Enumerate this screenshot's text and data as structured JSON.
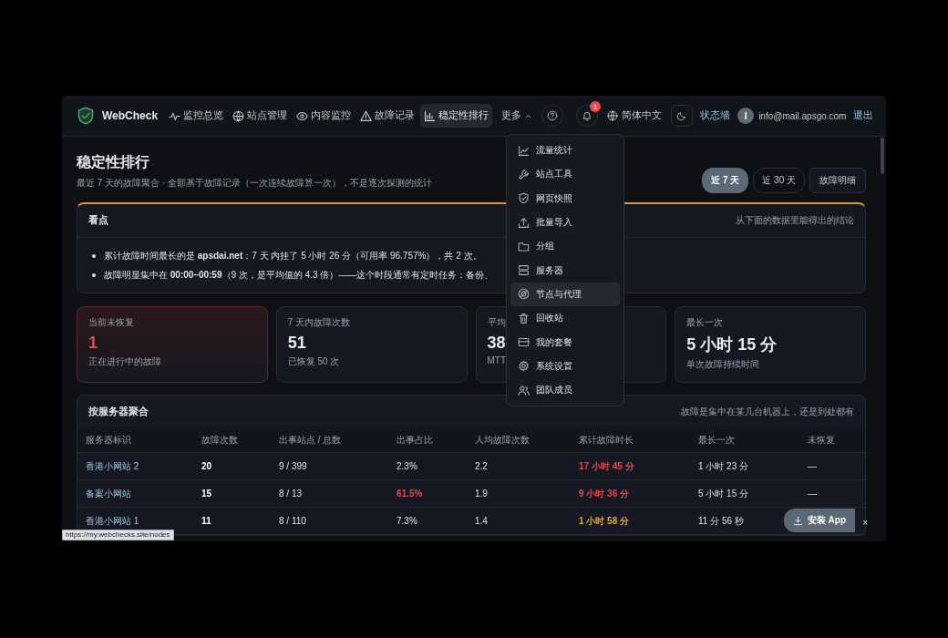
{
  "app": {
    "brand": "WebCheck"
  },
  "nav": [
    {
      "label": "监控总览",
      "selected": false
    },
    {
      "label": "站点管理",
      "selected": false
    },
    {
      "label": "内容监控",
      "selected": false
    },
    {
      "label": "故障记录",
      "selected": false
    },
    {
      "label": "稳定性排行",
      "selected": true
    }
  ],
  "more": {
    "label": "更多",
    "expanded": true
  },
  "notifications": {
    "count": "1"
  },
  "language": "简体中文",
  "status_wall": "状态墙",
  "user": {
    "initial": "I",
    "email": "info@mail.apsgo.com",
    "logout": "退出"
  },
  "menu": [
    {
      "label": "流量统计",
      "selected": false
    },
    {
      "label": "站点工具",
      "selected": false
    },
    {
      "label": "网页快照",
      "selected": false
    },
    {
      "label": "批量导入",
      "selected": false
    },
    {
      "label": "分组",
      "selected": false
    },
    {
      "label": "服务器",
      "selected": false
    },
    {
      "label": "节点与代理",
      "selected": true
    },
    {
      "label": "回收站",
      "selected": false
    },
    {
      "label": "我的套餐",
      "selected": false
    },
    {
      "label": "系统设置",
      "selected": false
    },
    {
      "label": "团队成员",
      "selected": false
    }
  ],
  "page": {
    "title": "稳定性排行",
    "subtitle": "最近 7 天的故障聚合 · 全部基于故障记录（一次连续故障算一次），不是逐次探测的统计"
  },
  "ranges": [
    {
      "label": "近 7 天",
      "selected": true
    },
    {
      "label": "近 30 天",
      "selected": false
    }
  ],
  "detail_button": "故障明细",
  "highlights": {
    "title": "看点",
    "note": "从下面的数据里能得出的结论",
    "items": [
      "累计故障时间最长的是 **apsdai.net**：7 天 内挂了 5 小时 26 分（可用率 96.757%），共 2 次。",
      "故障明显集中在 **00:00–00:59**（9 次，是平均值的 4.3 倍）——这个时段通常有定时任务：备份、"
    ]
  },
  "stats": [
    {
      "label": "当前未恢复",
      "value": "1",
      "sub": "正在进行中的故障",
      "alert": true
    },
    {
      "label": "7 天内故障次数",
      "value": "51",
      "sub": "已恢复 50 次",
      "alert": false
    },
    {
      "label": "平均",
      "value": "38",
      "sub": "MTT",
      "alert": false
    },
    {
      "label": "最长一次",
      "value": "5 小时 15 分",
      "sub": "单次故障持续时间",
      "alert": false
    }
  ],
  "table": {
    "title": "按服务器聚合",
    "note": "故障是集中在某几台机器上，还是到处都有",
    "columns": [
      "服务器标识",
      "故障次数",
      "出事站点 / 总数",
      "出事占比",
      "人均故障次数",
      "累计故障时长",
      "最长一次",
      "未恢复"
    ],
    "rows": [
      {
        "cells": [
          {
            "text": "香港小网站 2",
            "kind": "link"
          },
          {
            "text": "20",
            "kind": "bold"
          },
          {
            "text": "9 / 399",
            "kind": "plain"
          },
          {
            "text": "2.3%",
            "kind": "plain"
          },
          {
            "text": "2.2",
            "kind": "plain"
          },
          {
            "text": "17 小时 45 分",
            "kind": "danger"
          },
          {
            "text": "1 小时 23 分",
            "kind": "plain"
          },
          {
            "text": "—",
            "kind": "plain"
          }
        ]
      },
      {
        "cells": [
          {
            "text": "备案小网站",
            "kind": "link"
          },
          {
            "text": "15",
            "kind": "bold"
          },
          {
            "text": "8 / 13",
            "kind": "plain"
          },
          {
            "text": "61.5%",
            "kind": "danger"
          },
          {
            "text": "1.9",
            "kind": "plain"
          },
          {
            "text": "9 小时 36 分",
            "kind": "danger"
          },
          {
            "text": "5 小时 15 分",
            "kind": "plain"
          },
          {
            "text": "—",
            "kind": "plain"
          }
        ]
      },
      {
        "cells": [
          {
            "text": "香港小网站 1",
            "kind": "link"
          },
          {
            "text": "11",
            "kind": "bold"
          },
          {
            "text": "8 / 110",
            "kind": "plain"
          },
          {
            "text": "7.3%",
            "kind": "plain"
          },
          {
            "text": "1.4",
            "kind": "plain"
          },
          {
            "text": "1 小时 58 分",
            "kind": "warn"
          },
          {
            "text": "11 分 56 秒",
            "kind": "plain"
          }
        ]
      }
    ]
  },
  "install": {
    "label": "安装 App",
    "close": "×"
  },
  "status_url": "https://my.webchecks.site/nodes"
}
